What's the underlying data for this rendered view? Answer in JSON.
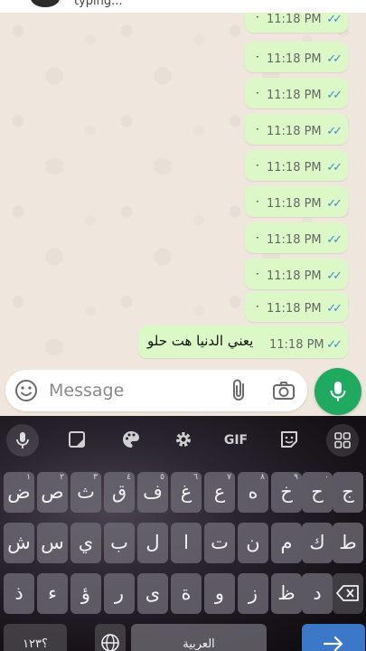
{
  "header": {
    "status": "typing..."
  },
  "messages": [
    {
      "time": "11:18 PM",
      "text": ""
    },
    {
      "time": "11:18 PM",
      "text": ""
    },
    {
      "time": "11:18 PM",
      "text": ""
    },
    {
      "time": "11:18 PM",
      "text": ""
    },
    {
      "time": "11:18 PM",
      "text": ""
    },
    {
      "time": "11:18 PM",
      "text": ""
    },
    {
      "time": "11:18 PM",
      "text": ""
    },
    {
      "time": "11:18 PM",
      "text": ""
    },
    {
      "time": "11:18 PM",
      "text": ""
    },
    {
      "time": "11:18 PM",
      "text": "يعني الدنيا هت حلو"
    }
  ],
  "input": {
    "placeholder": "Message"
  },
  "keyboard": {
    "toolbar": {
      "gif_label": "GIF"
    },
    "row1": [
      {
        "char": "ض",
        "hint": "١"
      },
      {
        "char": "ص",
        "hint": "٢"
      },
      {
        "char": "ث",
        "hint": "٣"
      },
      {
        "char": "ق",
        "hint": "٤"
      },
      {
        "char": "ف",
        "hint": "٥"
      },
      {
        "char": "غ",
        "hint": "٦"
      },
      {
        "char": "ع",
        "hint": "٧"
      },
      {
        "char": "ه",
        "hint": "٨"
      },
      {
        "char": "خ",
        "hint": "٩"
      },
      {
        "char": "ح",
        "hint": "٠"
      },
      {
        "char": "ج",
        "hint": ""
      }
    ],
    "row2": [
      {
        "char": "ش"
      },
      {
        "char": "س"
      },
      {
        "char": "ي"
      },
      {
        "char": "ب"
      },
      {
        "char": "ل"
      },
      {
        "char": "ا"
      },
      {
        "char": "ت"
      },
      {
        "char": "ن"
      },
      {
        "char": "م"
      },
      {
        "char": "ك"
      },
      {
        "char": "ط"
      }
    ],
    "row3": [
      {
        "char": "ذ"
      },
      {
        "char": "ء"
      },
      {
        "char": "ؤ"
      },
      {
        "char": "ر"
      },
      {
        "char": "ى"
      },
      {
        "char": "ة"
      },
      {
        "char": "و"
      },
      {
        "char": "ز"
      },
      {
        "char": "ظ"
      },
      {
        "char": "د"
      }
    ],
    "row4": {
      "symbols": "؟١٢٣",
      "space": "العربية"
    }
  },
  "colors": {
    "bubble": "#dcf8c6",
    "ticks": "#3a8fd6",
    "mic": "#1faa60"
  }
}
